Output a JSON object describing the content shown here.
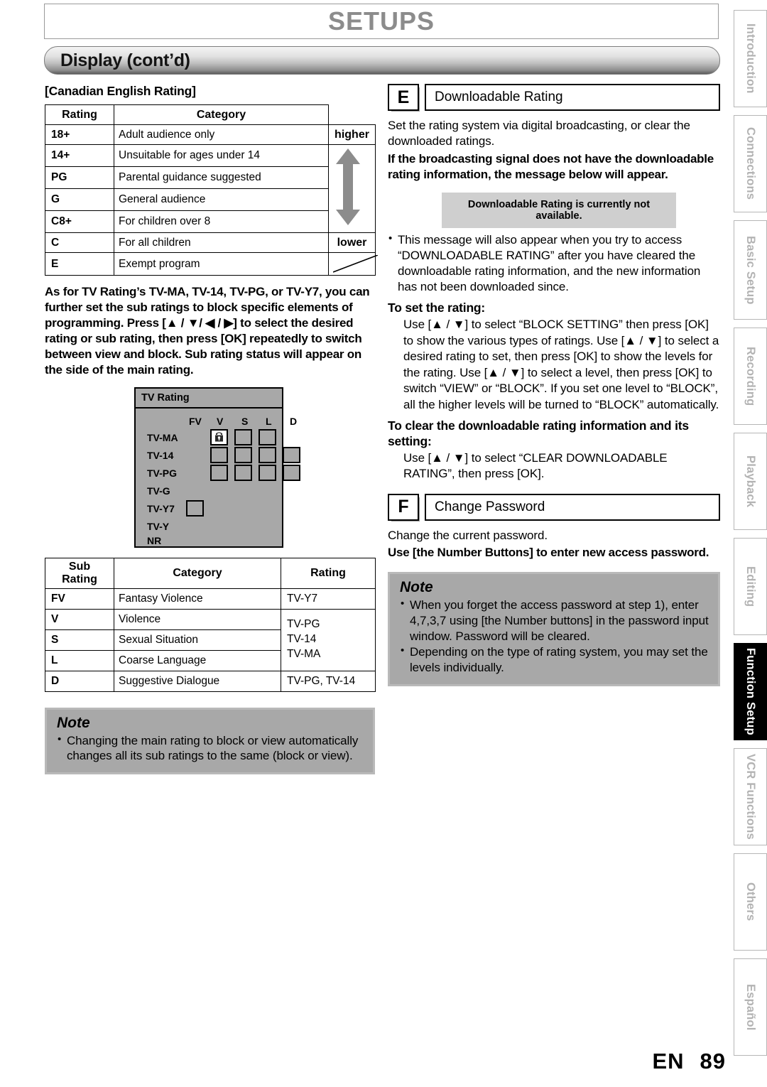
{
  "header": {
    "title": "SETUPS",
    "section": "Display (cont’d)"
  },
  "left": {
    "heading": "[Canadian English Rating]",
    "rating_table": {
      "headers": [
        "Rating",
        "Category"
      ],
      "rows": [
        {
          "rating": "18+",
          "category": "Adult audience only"
        },
        {
          "rating": "14+",
          "category": "Unsuitable for ages under 14"
        },
        {
          "rating": "PG",
          "category": "Parental guidance suggested"
        },
        {
          "rating": "G",
          "category": "General audience"
        },
        {
          "rating": "C8+",
          "category": "For children over 8"
        },
        {
          "rating": "C",
          "category": "For all children"
        },
        {
          "rating": "E",
          "category": "Exempt program"
        }
      ],
      "scale_high": "higher",
      "scale_low": "lower"
    },
    "tv_rating_paragraph": "As for TV Rating’s TV-MA, TV-14, TV-PG, or TV-Y7, you can further set the sub ratings to block specific elements of programming. Press [▲ / ▼/ ◀ / ▶] to select the desired rating or sub rating, then press [OK] repeatedly to switch between view and block. Sub rating status will appear on the side of the main rating.",
    "osd": {
      "title": "TV Rating",
      "columns": [
        "FV",
        "V",
        "S",
        "L",
        "D"
      ],
      "rows": [
        "TV-MA",
        "TV-14",
        "TV-PG",
        "TV-G",
        "TV-Y7",
        "TV-Y",
        "NR"
      ],
      "cells": {
        "TV-MA": [
          "",
          "lock",
          "box",
          "box",
          ""
        ],
        "TV-14": [
          "",
          "box",
          "box",
          "box",
          "box"
        ],
        "TV-PG": [
          "",
          "box",
          "box",
          "box",
          "box"
        ],
        "TV-G": [
          "",
          "",
          "",
          "",
          ""
        ],
        "TV-Y7": [
          "box",
          "",
          "",
          "",
          ""
        ],
        "TV-Y": [
          "",
          "",
          "",
          "",
          ""
        ],
        "NR": [
          "",
          "",
          "",
          "",
          ""
        ]
      }
    },
    "sub_table": {
      "headers": [
        "Sub Rating",
        "Category",
        "Rating"
      ],
      "rows": [
        {
          "sub": "FV",
          "category": "Fantasy Violence",
          "rating": "TV-Y7"
        },
        {
          "sub": "V",
          "category": "Violence",
          "rating": "TV-PG"
        },
        {
          "sub": "S",
          "category": "Sexual Situation",
          "rating": "TV-14"
        },
        {
          "sub": "L",
          "category": "Coarse Language",
          "rating": "TV-MA"
        },
        {
          "sub": "D",
          "category": "Suggestive Dialogue",
          "rating": "TV-PG, TV-14"
        }
      ]
    },
    "note": {
      "title": "Note",
      "items": [
        "Changing the main rating to block or view automatically changes all its sub ratings to the same (block or view)."
      ]
    }
  },
  "right": {
    "section_e": {
      "letter": "E",
      "label": "Downloadable Rating",
      "intro": "Set the rating system via digital broadcasting, or clear the downloaded ratings.",
      "bold_intro": "If the broadcasting signal does not have the downloadable rating information, the message below will appear.",
      "osd_message": "Downloadable Rating is currently not available.",
      "bullets": [
        "This message will also appear when you try to access “DOWNLOADABLE RATING” after you have cleared the downloadable rating information, and the new information has not been downloaded since."
      ],
      "set_heading": "To set the rating:",
      "set_body": "Use [▲ / ▼] to select “BLOCK SETTING” then press [OK] to show the various types of ratings. Use [▲ / ▼] to select a desired rating to set, then press [OK] to show the levels for the rating. Use [▲ / ▼] to select a level, then press [OK] to switch “VIEW” or “BLOCK”. If you set one level to “BLOCK”, all the higher levels will be turned to “BLOCK” automatically.",
      "clear_heading": "To clear the downloadable rating information and its setting:",
      "clear_body": "Use [▲ / ▼] to select “CLEAR DOWNLOADABLE RATING”, then press [OK]."
    },
    "section_f": {
      "letter": "F",
      "label": "Change Password",
      "intro": "Change the current password.",
      "bold_intro": "Use [the Number Buttons] to enter new access password."
    },
    "note": {
      "title": "Note",
      "items": [
        "When you forget the access password at step 1), enter 4,7,3,7 using [the Number buttons] in the password input window. Password will be cleared.",
        "Depending on the type of rating system, you may set the levels individually."
      ]
    }
  },
  "side_tabs": [
    {
      "label": "Introduction",
      "active": false
    },
    {
      "label": "Connections",
      "active": false
    },
    {
      "label": "Basic Setup",
      "active": false
    },
    {
      "label": "Recording",
      "active": false
    },
    {
      "label": "Playback",
      "active": false
    },
    {
      "label": "Editing",
      "active": false
    },
    {
      "label": "Function Setup",
      "active": true
    },
    {
      "label": "VCR Functions",
      "active": false
    },
    {
      "label": "Others",
      "active": false
    },
    {
      "label": "Español",
      "active": false
    }
  ],
  "footer": {
    "lang": "EN",
    "page": "89"
  }
}
